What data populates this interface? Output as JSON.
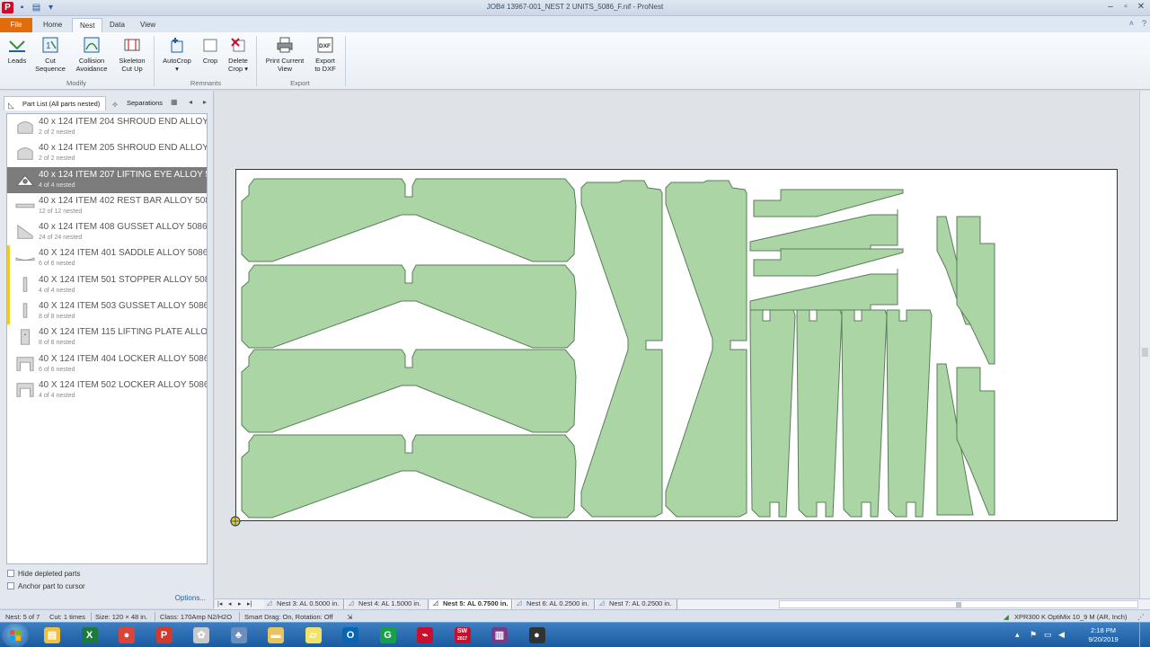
{
  "window": {
    "title": "JOB# 13967-001_NEST 2 UNITS_5086_F.nif - ProNest",
    "app_icon": "P"
  },
  "ribbon_tabs": [
    "File",
    "Home",
    "Nest",
    "Data",
    "View"
  ],
  "ribbon": {
    "modify": {
      "label": "Modify",
      "leads": "Leads",
      "cut_sequence": [
        "Cut",
        "Sequence"
      ],
      "collision_avoidance": [
        "Collision",
        "Avoidance"
      ],
      "skeleton_cut_up": [
        "Skeleton",
        "Cut Up"
      ]
    },
    "remnants": {
      "label": "Remnants",
      "autocrop": "AutoCrop",
      "autocrop_arrow": "▾",
      "crop": "Crop",
      "delete_crop": [
        "Delete",
        "Crop ▾"
      ]
    },
    "export": {
      "label": "Export",
      "print_current_view": [
        "Print Current",
        "View"
      ],
      "export_to_dxf": [
        "Export",
        "to DXF"
      ],
      "dxf_badge": "DXF"
    }
  },
  "left_panel": {
    "tab_part_list": "Part List  (All parts nested)",
    "tab_separations": "Separations",
    "parts": [
      {
        "name": "40 x 124 ITEM 204 SHROUD END  ALLOY 5086",
        "count": "2 of 2 nested",
        "shape": "shroud",
        "selected": false,
        "flag": false
      },
      {
        "name": "40 x 124 ITEM 205 SHROUD END  ALLOY 5086",
        "count": "2 of 2 nested",
        "shape": "shroud",
        "selected": false,
        "flag": false
      },
      {
        "name": "40 x 124 ITEM 207 LIFTING EYE ALLOY 5086",
        "count": "4 of 4 nested",
        "shape": "eye",
        "selected": true,
        "flag": false
      },
      {
        "name": "40 x 124 ITEM 402 REST BAR ALLOY 5086",
        "count": "12 of 12 nested",
        "shape": "bar",
        "selected": false,
        "flag": false
      },
      {
        "name": "40 x 124 ITEM 408 GUSSET ALLOY 5086",
        "count": "24 of 24 nested",
        "shape": "gusset",
        "selected": false,
        "flag": false
      },
      {
        "name": "40 X 124 ITEM 401 SADDLE ALLOY 5086",
        "count": "6 of 6 nested",
        "shape": "saddle",
        "selected": false,
        "flag": true
      },
      {
        "name": "40 X 124 ITEM 501 STOPPER ALLOY 5086",
        "count": "4 of 4 nested",
        "shape": "stopper",
        "selected": false,
        "flag": true
      },
      {
        "name": "40 X 124 ITEM 503 GUSSET ALLOY 5086",
        "count": "8 of 8 nested",
        "shape": "stopper",
        "selected": false,
        "flag": true
      },
      {
        "name": "40 X 124 ITEM 115 LIFTING PLATE ALLOY 5086",
        "count": "8 of 8 nested",
        "shape": "plate",
        "selected": false,
        "flag": false
      },
      {
        "name": "40 X 124 ITEM 404 LOCKER ALLOY 5086",
        "count": "6 of 6 nested",
        "shape": "locker",
        "selected": false,
        "flag": false
      },
      {
        "name": "40 X 124 ITEM 502 LOCKER ALLOY 5086",
        "count": "4 of 4 nested",
        "shape": "locker",
        "selected": false,
        "flag": false
      }
    ],
    "hide_depleted": "Hide depleted parts",
    "anchor_part": "Anchor part to cursor",
    "options": "Options..."
  },
  "nest_tabs": [
    {
      "label": "Nest 3: AL 0.5000 in.",
      "active": false
    },
    {
      "label": "Nest 4: AL 1.5000 in.",
      "active": false
    },
    {
      "label": "Nest 5: AL 0.7500 in.",
      "active": true
    },
    {
      "label": "Nest 6: AL 0.2500 in.",
      "active": false
    },
    {
      "label": "Nest 7: AL 0.2500 in.",
      "active": false
    }
  ],
  "status": {
    "nest": "Nest: 5 of 7",
    "cut": "Cut: 1 times",
    "size": "Size: 120 × 48 in.",
    "class": "Class: 170Amp N2/H2O",
    "smart_drag": "Smart Drag: On, Rotation: Off",
    "machine": "XPR300 K OptiMix 10_9 M (AR, Inch)"
  },
  "taskbar": {
    "time": "2:18 PM",
    "date": "9/20/2019",
    "apps": [
      "windows-explorer",
      "excel",
      "chrome",
      "pronest",
      "app5",
      "app6",
      "file-explorer",
      "sticky-notes",
      "outlook",
      "grammarly",
      "acrobat",
      "solidworks",
      "winrar",
      "recorder"
    ],
    "sw_label": "SW",
    "sw_year": "2017"
  },
  "colors": {
    "part_fill": "#abd5a5",
    "part_stroke": "#5a7d5a",
    "accent_file": "#e36c0a",
    "selected_row": "#7c7c7c"
  }
}
